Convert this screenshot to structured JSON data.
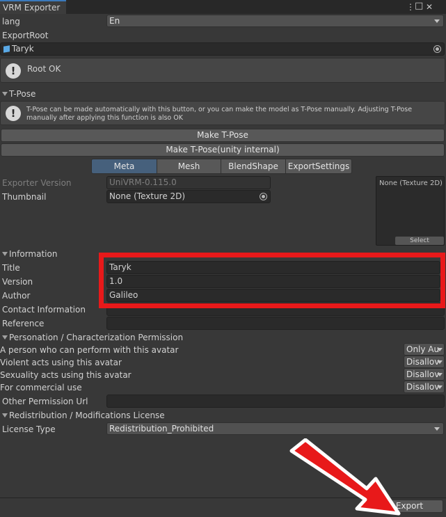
{
  "window": {
    "title": "VRM Exporter",
    "menu_glyph": "⋮",
    "maximize_glyph": "□",
    "close_glyph": "✕"
  },
  "lang": {
    "label": "lang",
    "value": "En"
  },
  "export_root": {
    "label": "ExportRoot",
    "value": "Taryk",
    "status": "Root OK"
  },
  "tpose": {
    "header": "T-Pose",
    "help": "T-Pose can be made automatically with this button, or you can make the model as T-Pose manually. Adjusting T-Pose manually after applying this function is also OK",
    "make_button": "Make T-Pose",
    "make_internal_button": "Make T-Pose(unity internal)"
  },
  "tabs": [
    {
      "label": "Meta",
      "active": true
    },
    {
      "label": "Mesh",
      "active": false
    },
    {
      "label": "BlendShape",
      "active": false
    },
    {
      "label": "ExportSettings",
      "active": false
    }
  ],
  "meta": {
    "exporter_version_label": "Exporter Version",
    "exporter_version_value": "UniVRM-0.115.0",
    "thumbnail_label": "Thumbnail",
    "thumbnail_value": "None (Texture 2D)",
    "preview_text": "None (Texture 2D)",
    "select_button": "Select"
  },
  "information": {
    "header": "Information",
    "fields": [
      {
        "label": "Title",
        "value": "Taryk"
      },
      {
        "label": "Version",
        "value": "1.0"
      },
      {
        "label": "Author",
        "value": "Galileo"
      },
      {
        "label": "Contact Information",
        "value": ""
      },
      {
        "label": "Reference",
        "value": ""
      }
    ]
  },
  "permission": {
    "header": "Personation / Characterization Permission",
    "rows": [
      {
        "label": "A person who can perform with this avatar",
        "value": "Only Au"
      },
      {
        "label": "Violent acts using this avatar",
        "value": "Disallov"
      },
      {
        "label": "Sexuality acts using this avatar",
        "value": "Disallov"
      },
      {
        "label": "For commercial use",
        "value": "Disallov"
      }
    ],
    "other_url_label": "Other Permission Url",
    "other_url_value": ""
  },
  "license": {
    "header": "Redistribution / Modifications License",
    "type_label": "License Type",
    "type_value": "Redistribution_Prohibited"
  },
  "export_button": "Export",
  "colors": {
    "highlight_box": "#e8191a",
    "arrow_fill": "#e8191a",
    "active_tab": "#46607c",
    "background": "#383838"
  }
}
